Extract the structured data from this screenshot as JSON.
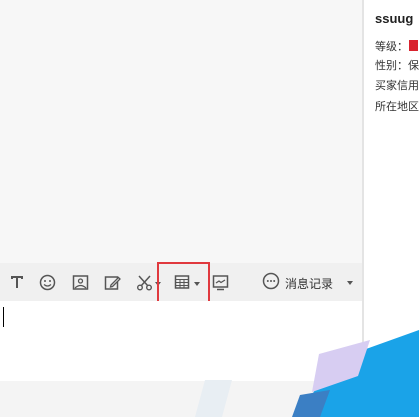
{
  "chat": {},
  "toolbar": {
    "icons": [
      {
        "name": "font-icon"
      },
      {
        "name": "emoji-icon"
      },
      {
        "name": "image-icon"
      },
      {
        "name": "edit-icon"
      },
      {
        "name": "scissors-icon"
      },
      {
        "name": "table-icon"
      },
      {
        "name": "screen-icon"
      }
    ],
    "history_label": "消息记录"
  },
  "profile": {
    "name": "ssuug",
    "level_label": "等级：",
    "gender_label": "性别：保",
    "credit_label": "买家信用",
    "region_label": "所在地区"
  },
  "colors": {
    "highlight": "#e0393e",
    "level_badge": "#d9232e",
    "logo_blue": "#1aa3e8"
  }
}
